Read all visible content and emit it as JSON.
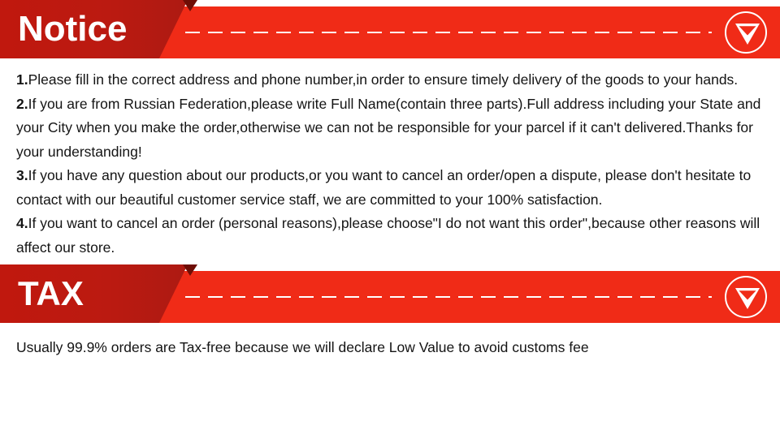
{
  "colors": {
    "ribbon_dark": "#bb1a11",
    "band_bright": "#f02b17",
    "fold_shadow": "#6e0d05",
    "text": "#141414",
    "white": "#ffffff"
  },
  "notice": {
    "banner": {
      "title": "Notice",
      "arrow_icon": "chevron-down-icon"
    },
    "items": [
      {
        "number": "1.",
        "text": "Please fill in the correct address and phone number,in order to ensure timely delivery of the goods to your hands."
      },
      {
        "number": "2.",
        "text": "If you are from Russian Federation,please write Full Name(contain three parts).Full address including your State and your City when you make the order,otherwise we can not be responsible for your parcel if it can't delivered.Thanks for your understanding!"
      },
      {
        "number": "3.",
        "text": "If you have any question about our products,or you want to cancel an order/open a dispute, please don't hesitate to contact with our beautiful customer service staff, we are committed to your 100% satisfaction."
      },
      {
        "number": "4.",
        "text": "If you want to cancel an order (personal reasons),please choose\"I do not want this order\",because other reasons will affect our store."
      }
    ]
  },
  "tax": {
    "banner": {
      "title": "TAX",
      "arrow_icon": "chevron-down-icon"
    },
    "paragraph": "Usually 99.9% orders are Tax-free because we will declare Low Value to avoid customs fee"
  }
}
